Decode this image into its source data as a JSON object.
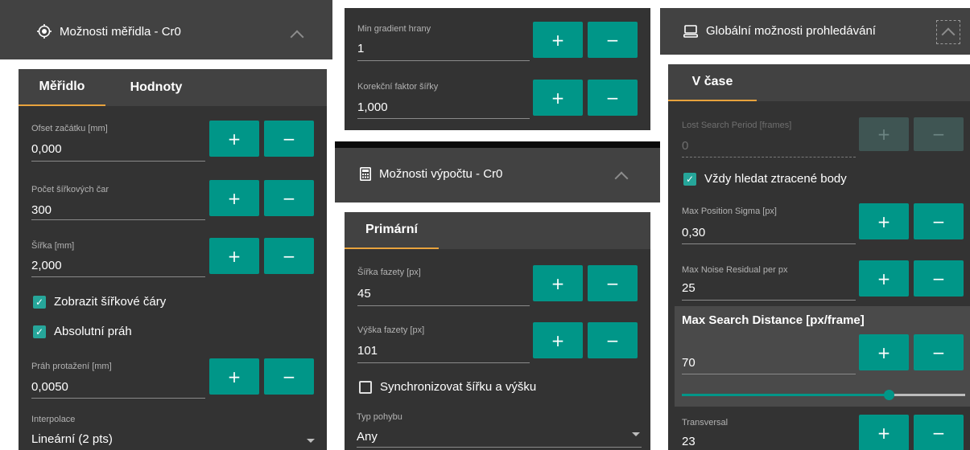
{
  "left_panel": {
    "title": "Možnosti měřidla - Cr0",
    "tabs": [
      "Měřidlo",
      "Hodnoty"
    ],
    "fields": [
      {
        "label": "Ofset začátku [mm]",
        "value": "0,000"
      },
      {
        "label": "Počet šířkových čar",
        "value": "300"
      },
      {
        "label": "Šířka [mm]",
        "value": "2,000"
      },
      {
        "label": "Práh protažení [mm]",
        "value": "0,0050"
      }
    ],
    "checkboxes": [
      {
        "label": "Zobrazit šířkové čáry",
        "checked": true
      },
      {
        "label": "Absolutní práh",
        "checked": true
      }
    ],
    "interpolation": {
      "label": "Interpolace",
      "value": "Lineární (2 pts)"
    }
  },
  "middle_panel": {
    "top_fields": [
      {
        "label": "Min gradient hrany",
        "value": "1"
      },
      {
        "label": "Korekční faktor šířky",
        "value": "1,000"
      }
    ],
    "title": "Možnosti výpočtu - Cr0",
    "tabs": [
      "Primární"
    ],
    "fields": [
      {
        "label": "Šířka fazety [px]",
        "value": "45"
      },
      {
        "label": "Výška fazety [px]",
        "value": "101"
      }
    ],
    "checkbox": {
      "label": "Synchronizovat šířku a výšku",
      "checked": false
    },
    "motion": {
      "label": "Typ pohybu",
      "value": "Any"
    }
  },
  "right_panel": {
    "title": "Globální možnosti prohledávání",
    "tabs": [
      "V čase"
    ],
    "lost_search": {
      "label": "Lost Search Period [frames]",
      "value": "0"
    },
    "checkbox": {
      "label": "Vždy hledat ztracené body",
      "checked": true
    },
    "fields": [
      {
        "label": "Max Position Sigma [px]",
        "value": "0,30"
      },
      {
        "label": "Max Noise Residual per px",
        "value": "25"
      }
    ],
    "max_search": {
      "label": "Max Search Distance [px/frame]",
      "value": "70",
      "slider_fraction": 0.73
    },
    "transversal": {
      "label": "Transversal",
      "value": "23"
    }
  },
  "buttons": {
    "plus": "+",
    "minus": "−"
  },
  "icons": {
    "check": "✓"
  },
  "colors": {
    "accent": "#009688",
    "tab_indicator": "#e8a33d",
    "checkbox": "#26a69a"
  }
}
